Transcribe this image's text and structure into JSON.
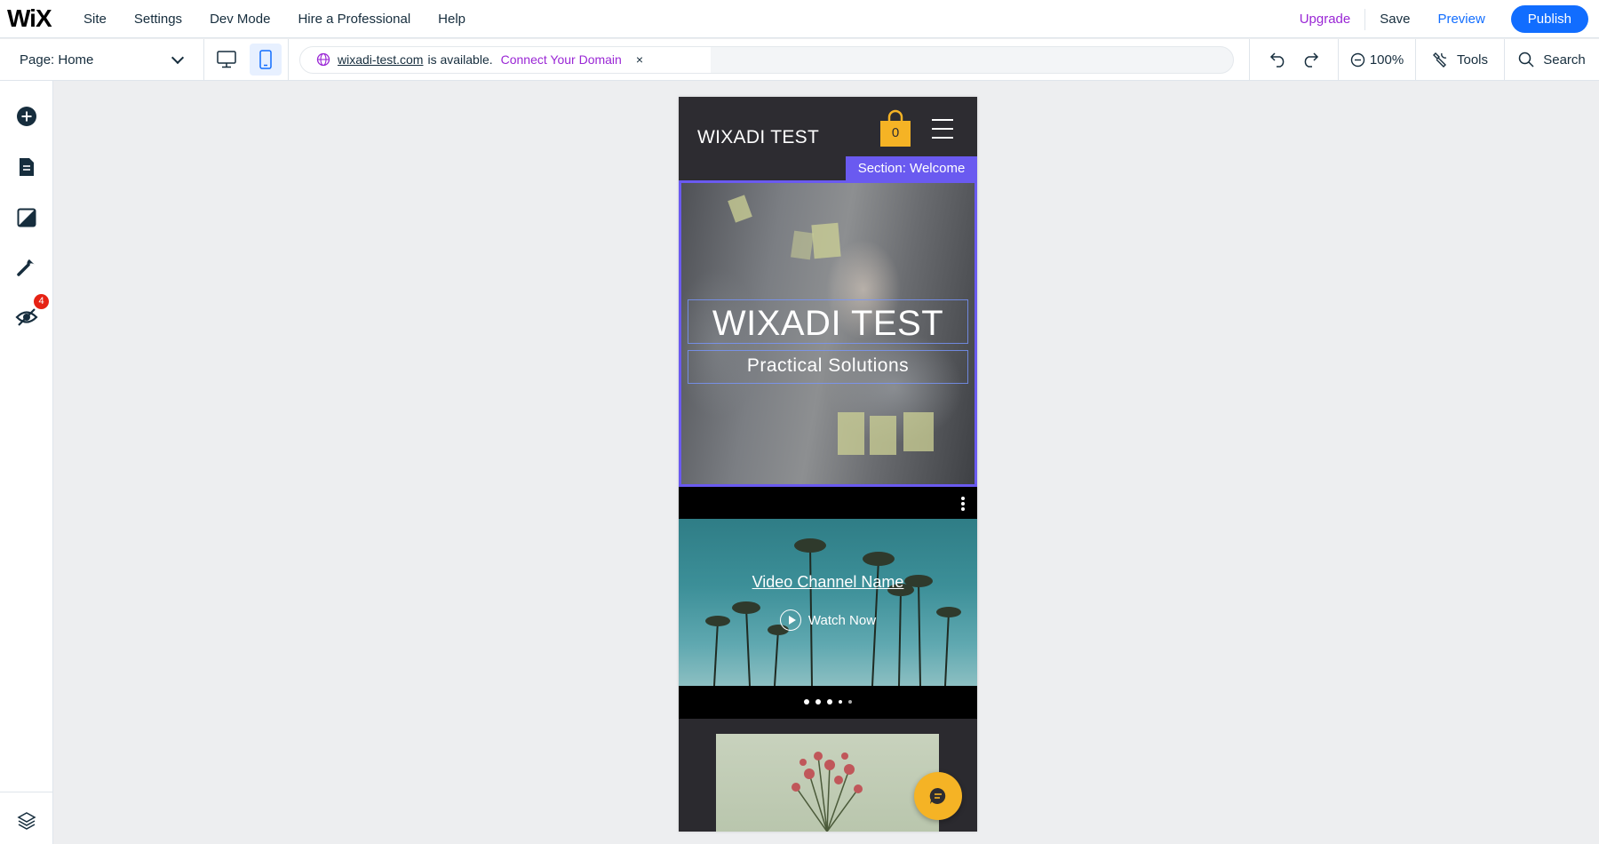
{
  "app": {
    "logo": "WiX",
    "menu": [
      "Site",
      "Settings",
      "Dev Mode",
      "Hire a Professional",
      "Help"
    ],
    "upgrade": "Upgrade",
    "save": "Save",
    "preview": "Preview",
    "publish": "Publish"
  },
  "toolbar": {
    "page_label": "Page: Home",
    "domain_name": "wixadi-test.com",
    "domain_text": "is available.",
    "connect_domain": "Connect Your Domain",
    "close_glyph": "×",
    "zoom": "100%",
    "tools": "Tools",
    "search": "Search"
  },
  "sidebar": {
    "icons": [
      "add-icon",
      "pages-icon",
      "design-icon",
      "wrench-icon",
      "visibility-icon",
      "layers-icon"
    ],
    "notification_count": "4"
  },
  "site": {
    "header_title": "WIXADI TEST",
    "cart_count": "0",
    "section_tag": "Section: Welcome",
    "hero_title": "WIXADI TEST",
    "hero_subtitle": "Practical Solutions",
    "video_channel": "Video Channel Name",
    "watch_now": "Watch Now",
    "slider_dots": 5,
    "active_dot": 1
  },
  "colors": {
    "accent_blue": "#116dff",
    "upgrade_purple": "#9a27d5",
    "section_purple": "#6a5af0",
    "cart_yellow": "#f5b325",
    "notification_red": "#e62214"
  }
}
